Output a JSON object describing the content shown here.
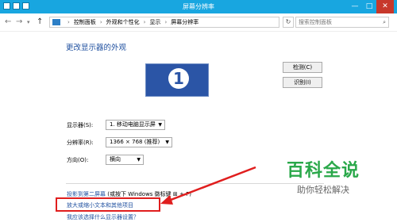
{
  "window": {
    "title": "屏幕分辨率"
  },
  "window_controls": {
    "minimize": "—",
    "maximize": "□",
    "close": "✕"
  },
  "nav": {
    "back": "←",
    "forward": "→",
    "history": "▾",
    "up": "↑"
  },
  "address_bar": {
    "crumbs": [
      "控制面板",
      "外观和个性化",
      "显示",
      "屏幕分辨率"
    ],
    "refresh": "↻"
  },
  "search": {
    "placeholder": "搜索控制面板"
  },
  "main": {
    "heading": "更改显示器的外观",
    "monitor_number": "1",
    "detect_button": "检测(C)",
    "identify_button": "识别(I)",
    "display_label": "显示器(S):",
    "display_value": "1. 移动电脑显示屏",
    "resolution_label": "分辨率(R):",
    "resolution_value": "1366 × 768 (推荐)",
    "orientation_label": "方向(O):",
    "orientation_value": "横向",
    "project_link": "投影到第二屏幕",
    "project_hint": "(或按下 Windows 徽标键 ⊞ + P)",
    "magnify_link": "放大或缩小文本和其他项目",
    "which_settings_link": "我应该选择什么显示器设置？"
  },
  "watermark": {
    "title": "百科全说",
    "subtitle": "助你轻松解决"
  },
  "colors": {
    "titlebar": "#18a6e0",
    "link": "#1e4f9f",
    "highlight": "#e01e1e",
    "watermark": "#2aa84a"
  }
}
